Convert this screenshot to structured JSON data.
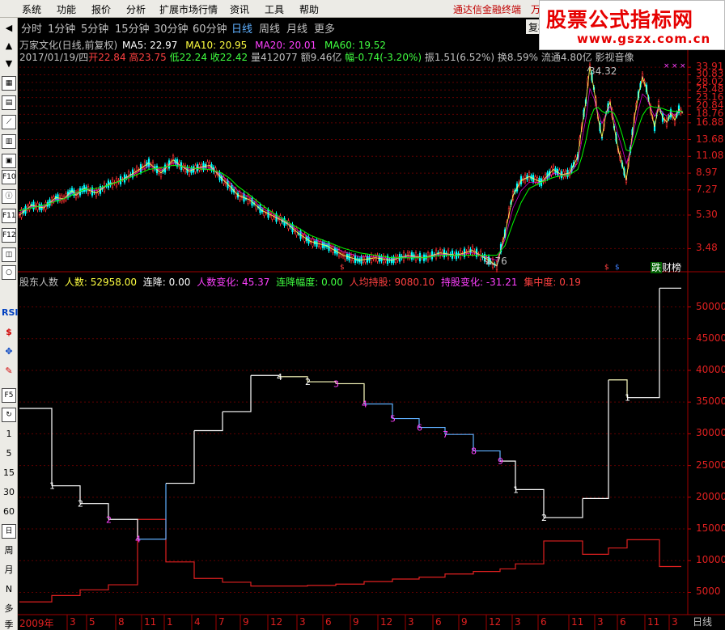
{
  "menu": [
    "系统",
    "功能",
    "报价",
    "分析",
    "扩展市场行情",
    "资讯",
    "工具",
    "帮助"
  ],
  "notice": "通达信金融终端　万",
  "watermark": {
    "title": "股票公式指标网",
    "url": "www.gszx.com.cn"
  },
  "tabs": [
    "分时",
    "1分钟",
    "5分钟",
    "15分钟",
    "30分钟",
    "60分钟",
    "日线",
    "周线",
    "月线",
    "更多"
  ],
  "active_tab": "日线",
  "fq_button": "复权",
  "toolbar": {
    "icons": [
      "left-arrow-icon",
      "up-arrow-icon",
      "down-arrow-icon",
      "grid-icon",
      "table-icon",
      "list-icon",
      "trend-icon",
      "candle-icon",
      "layout-icon",
      "f10-icon",
      "info-icon",
      "f11-icon",
      "f12-icon",
      "window-icon",
      "circle-icon"
    ],
    "labels": [
      "F10",
      "F11",
      "F12",
      "RSI",
      "$",
      "F5",
      "1",
      "5",
      "15",
      "30",
      "60",
      "日",
      "周",
      "月",
      "N",
      "多",
      "季"
    ]
  },
  "price_panel": {
    "title_line": {
      "name": "万家文化(日线,前复权)",
      "ma5": "MA5: 22.97",
      "ma10": "MA10: 20.95",
      "ma20": "MA20: 20.01",
      "ma60": "MA60: 19.52"
    },
    "info_line": {
      "date": "2017/01/19/四",
      "open": "开22.84",
      "high": "高23.75",
      "low": "低22.24",
      "close": "收22.42",
      "volume": "量412077",
      "amount": "额9.46亿",
      "change": "幅-0.74(-3.20%)",
      "amplitude": "振1.51(6.52%)",
      "turnover": "换8.59%",
      "float": "流通4.80亿",
      "sector": "影视音像"
    },
    "max_label": "34.32",
    "min_label": "2.76",
    "bottom_right": [
      "跌",
      "财",
      "榜"
    ]
  },
  "holder_panel": {
    "title": "股东人数",
    "holders": "人数: 52958.00",
    "cons_down": "连降: 0.00",
    "holders_change": "人数变化: 45.37",
    "down_range": "连降幅度: 0.00",
    "per_holding": "人均持股: 9080.10",
    "holding_change": "持股变化: -31.21",
    "concentration": "集中度: 0.19"
  },
  "x_axis": {
    "year": "2009年",
    "months": [
      "3",
      "5",
      "8",
      "11",
      "1",
      "4",
      "7",
      "9",
      "12",
      "3",
      "6",
      "9",
      "12",
      "3",
      "6",
      "9",
      "12",
      "3",
      "6",
      "11",
      "3",
      "6",
      "11",
      "3",
      "11"
    ]
  },
  "day_button": "日线",
  "colors": {
    "ma5": "#ffffff",
    "ma10": "#ffff00",
    "ma20": "#ff00ff",
    "ma60": "#00ff00",
    "up": "#ff3030",
    "down": "#00ffff",
    "axis": "#c00000"
  },
  "chart_data": [
    {
      "type": "line",
      "name": "price",
      "y_ticks": [
        33.91,
        30.83,
        28.02,
        25.48,
        23.16,
        20.84,
        18.76,
        16.88,
        13.68,
        11.08,
        8.97,
        7.27,
        5.3,
        3.48
      ],
      "x": [
        0,
        15,
        30,
        45,
        55,
        65,
        70,
        80,
        95,
        110,
        120,
        130,
        145,
        160,
        175,
        185,
        190,
        200,
        210,
        220,
        235,
        250,
        260,
        270,
        285,
        300,
        315,
        330,
        345,
        360,
        380,
        400,
        420,
        440,
        460,
        480,
        500,
        520,
        540,
        560,
        580,
        590,
        600,
        610,
        620,
        630,
        645,
        660,
        670,
        680,
        690,
        695,
        700,
        705,
        710,
        715,
        720,
        725,
        730,
        735,
        740,
        745,
        750,
        755,
        760,
        765,
        770,
        775,
        780,
        785,
        790,
        795,
        800,
        805,
        810,
        815,
        820
      ],
      "close": [
        5.3,
        6.0,
        5.8,
        6.6,
        6.5,
        7.2,
        6.8,
        7.4,
        7.0,
        7.8,
        8.0,
        8.4,
        9.2,
        10.2,
        9.0,
        10.0,
        10.6,
        9.8,
        9.2,
        9.6,
        9.9,
        8.4,
        7.6,
        6.8,
        6.4,
        5.6,
        5.2,
        4.8,
        4.2,
        3.8,
        3.6,
        3.2,
        3.0,
        3.1,
        3.0,
        3.2,
        3.1,
        3.3,
        3.2,
        3.4,
        3.0,
        2.8,
        4.2,
        6.8,
        8.2,
        8.6,
        8.0,
        9.4,
        8.8,
        9.0,
        11.0,
        16.0,
        22.0,
        34.32,
        26.0,
        18.0,
        14.0,
        19.0,
        22.0,
        16.0,
        12.0,
        10.0,
        8.2,
        12.0,
        18.0,
        24.0,
        30.0,
        26.0,
        20.0,
        16.0,
        21.0,
        18.0,
        17.0,
        19.0,
        17.5,
        20.0,
        19.0
      ],
      "ma": [
        5.6,
        5.8,
        6.0,
        6.3,
        6.5,
        6.8,
        7.0,
        7.3,
        7.4,
        7.7,
        8.0,
        8.3,
        8.8,
        9.4,
        9.6,
        9.8,
        9.9,
        9.8,
        9.6,
        9.5,
        9.4,
        9.0,
        8.4,
        7.6,
        6.8,
        6.0,
        5.4,
        4.9,
        4.5,
        4.1,
        3.8,
        3.5,
        3.3,
        3.2,
        3.1,
        3.1,
        3.1,
        3.2,
        3.2,
        3.2,
        3.2,
        3.2,
        3.6,
        4.8,
        6.2,
        7.4,
        8.0,
        8.5,
        8.7,
        8.8,
        9.4,
        11.0,
        13.5,
        17.5,
        20.0,
        20.5,
        19.5,
        19.0,
        19.5,
        19.0,
        17.0,
        14.5,
        12.0,
        11.8,
        13.5,
        16.0,
        18.5,
        20.0,
        20.8,
        20.5,
        20.4,
        20.2,
        19.8,
        19.6,
        19.5,
        19.5,
        19.5
      ]
    },
    {
      "type": "line",
      "name": "holders",
      "y_ticks": [
        50000,
        45000,
        40000,
        35000,
        30000,
        25000,
        20000,
        15000,
        10000,
        5000
      ],
      "ylim": [
        2000,
        53000
      ],
      "steps_x": [
        24,
        64,
        99,
        134,
        170,
        205,
        240,
        275,
        310,
        345,
        380,
        415,
        450,
        485,
        518,
        550,
        585,
        618,
        637,
        672,
        720,
        752,
        775,
        815,
        842
      ],
      "holders": [
        34000,
        21800,
        19000,
        16500,
        13400,
        22200,
        30500,
        33500,
        39200,
        39000,
        38200,
        37900,
        34700,
        32400,
        31000,
        29900,
        27300,
        25700,
        21200,
        16800,
        19800,
        38500,
        35700,
        52958,
        52958
      ],
      "per_holding": [
        3500,
        4500,
        5400,
        6200,
        16500,
        9800,
        7200,
        6600,
        6000,
        6000,
        6100,
        6300,
        6700,
        7100,
        7400,
        7900,
        8300,
        8700,
        9500,
        13100,
        11000,
        12000,
        13300,
        9080,
        9080
      ],
      "step_labels": [
        "1",
        "2",
        "2",
        "4",
        "4",
        "2",
        "3",
        "4",
        "5",
        "6",
        "7",
        "8",
        "9",
        "1",
        "2",
        "1"
      ]
    }
  ]
}
